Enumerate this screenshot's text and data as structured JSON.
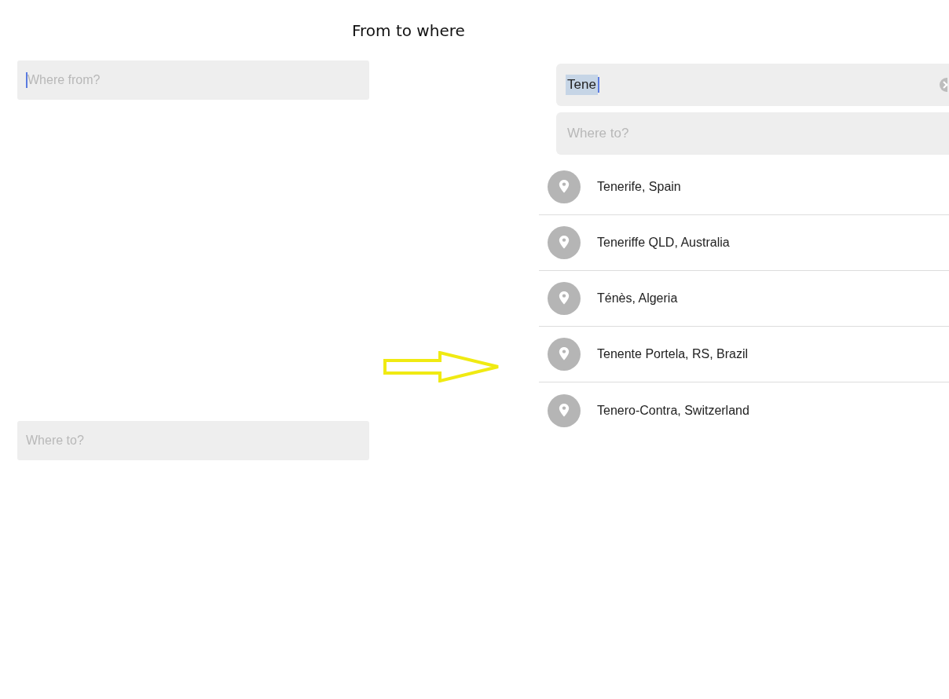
{
  "title": "From to where",
  "first_screen": {
    "from_field": {
      "placeholder": "Where from?",
      "focused": true
    },
    "to_field": {
      "placeholder": "Where to?",
      "focused": false
    }
  },
  "second_screen": {
    "from_field": {
      "value": "Tene",
      "focused": true
    },
    "to_field": {
      "placeholder": "Where to?",
      "focused": false
    },
    "suggestions": [
      {
        "label": "Tenerife, Spain"
      },
      {
        "label": "Teneriffe QLD, Australia"
      },
      {
        "label": "Ténès, Algeria"
      },
      {
        "label": "Tenente Portela, RS, Brazil"
      },
      {
        "label": "Tenero-Contra, Switzerland"
      }
    ]
  }
}
